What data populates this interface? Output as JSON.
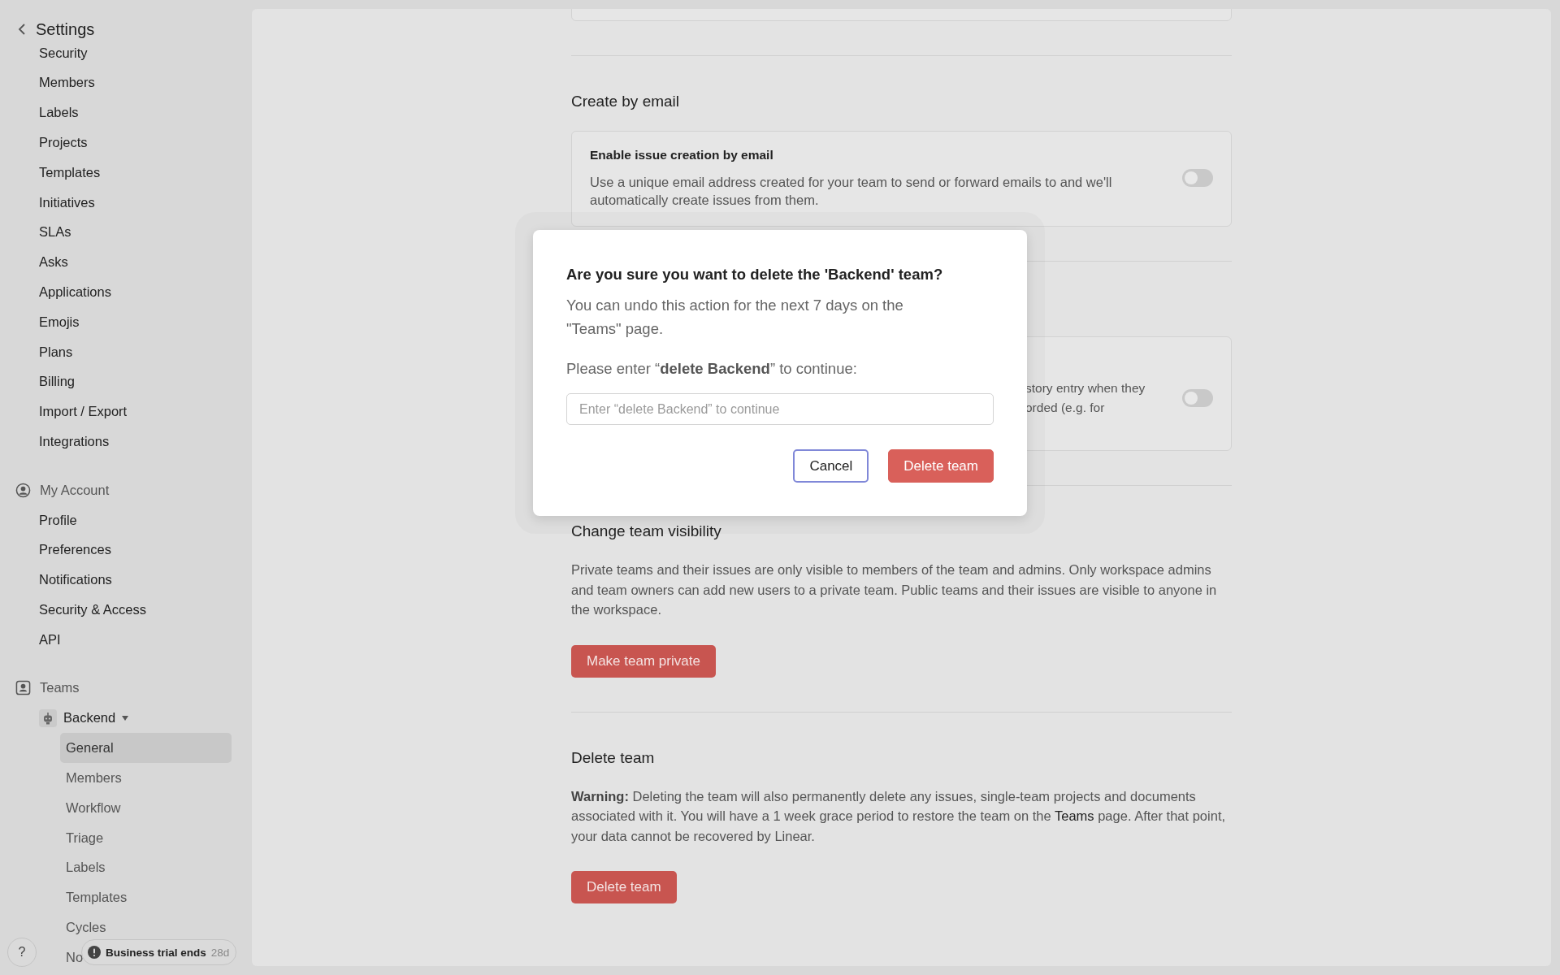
{
  "sidebar": {
    "title": "Settings",
    "items": [
      {
        "label": "Security",
        "selected": false
      },
      {
        "label": "Members",
        "selected": false
      },
      {
        "label": "Labels",
        "selected": false
      },
      {
        "label": "Projects",
        "selected": false
      },
      {
        "label": "Templates",
        "selected": false
      },
      {
        "label": "Initiatives",
        "selected": false
      },
      {
        "label": "SLAs",
        "selected": false
      },
      {
        "label": "Asks",
        "selected": false
      },
      {
        "label": "Applications",
        "selected": false
      },
      {
        "label": "Emojis",
        "selected": false
      },
      {
        "label": "Plans",
        "selected": false
      },
      {
        "label": "Billing",
        "selected": false
      },
      {
        "label": "Import / Export",
        "selected": false
      },
      {
        "label": "Integrations",
        "selected": false
      }
    ],
    "sections": [
      {
        "kind": "account",
        "title": "My Account",
        "items": [
          {
            "label": "Profile",
            "selected": false
          },
          {
            "label": "Preferences",
            "selected": false
          },
          {
            "label": "Notifications",
            "selected": false
          },
          {
            "label": "Security & Access",
            "selected": false
          },
          {
            "label": "API",
            "selected": false
          }
        ]
      },
      {
        "kind": "teams",
        "title": "Teams",
        "team": {
          "name": "Backend",
          "items": [
            {
              "label": "General",
              "selected": true
            },
            {
              "label": "Members",
              "selected": false
            },
            {
              "label": "Workflow",
              "selected": false
            },
            {
              "label": "Triage",
              "selected": false
            },
            {
              "label": "Labels",
              "selected": false
            },
            {
              "label": "Templates",
              "selected": false
            },
            {
              "label": "Cycles",
              "selected": false
            },
            {
              "label": "No",
              "selected": false
            }
          ]
        }
      }
    ],
    "help_button": "?",
    "trial_badge": {
      "text": "Business trial ends",
      "days": "28d"
    }
  },
  "main": {
    "sections": [
      {
        "kind": "card_stub"
      },
      {
        "kind": "toggle",
        "heading": "Create by email",
        "title": "Enable issue creation by email",
        "description": "Use a unique email address created for your team to send or forward emails to and we'll automatically create issues from them.",
        "on": false
      },
      {
        "kind": "toggle_partial",
        "lines": [
          "story entry when they",
          "orded (e.g. for"
        ],
        "on": false
      },
      {
        "kind": "action",
        "heading": "Change team visibility",
        "text": "Private teams and their issues are only visible to members of the team and admins. Only workspace admins and team owners can add new users to a private team. Public teams and their issues are visible to anyone in the workspace.",
        "button": "Make team private"
      },
      {
        "kind": "action",
        "heading": "Delete team",
        "text": "**Warning:** Deleting the team will also permanently delete any issues, single-team projects and documents associated with it. You will have a 1 week grace period to restore the team on the",
        "link": "Teams",
        "text_after": "page. After that point, your data cannot be recovered by Linear.",
        "button": "Delete team"
      }
    ]
  },
  "dialog": {
    "title": "Are you sure you want to delete the 'Backend' team?",
    "body": "You can undo this action for the next 7 days on the \"Teams\" page.",
    "prompt": "Please enter “**delete Backend**” to continue:",
    "placeholder": "Enter “delete Backend” to continue",
    "buttons": [
      {
        "label": "Cancel",
        "kind": "secondary",
        "focused": true
      },
      {
        "label": "Delete team",
        "kind": "danger",
        "focused": false
      }
    ]
  }
}
